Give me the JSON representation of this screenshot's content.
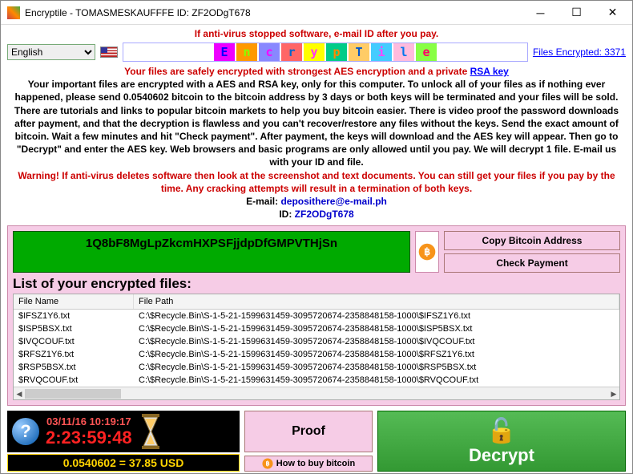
{
  "window": {
    "title": "Encryptile -   TOMASMESKAUFFFE ID: ZF2ODgT678"
  },
  "header": {
    "warning_top": "If anti-virus stopped software, e-mail ID after you pay.",
    "language": "English",
    "banner_letters": [
      "E",
      "n",
      "c",
      "r",
      "y",
      "p",
      "T",
      "i",
      "l",
      "e"
    ],
    "files_encrypted_label": "Files Encrypted: 3371"
  },
  "main_text": {
    "line1_prefix": "Your files are safely encrypted with strongest AES encryption and a private ",
    "rsa_link": "RSA key",
    "body": "Your important files are encrypted with a AES and RSA key, only for this computer. To unlock all of your files as if nothing ever happened, please send 0.0540602 bitcoin to the bitcoin address by 3 days or both keys will be terminated and your files will be sold. There are tutorials and links to popular bitcoin markets to help you buy bitcoin easier. There is video proof the password downloads after payment, and that the decryption is flawless and you can't recover/restore any files without the keys. Send the exact amount of bitcoin. Wait a few minutes and hit \"Check payment\". After payment, the keys will download and the AES key will appear. Then go to \"Decrypt\" and enter the AES key. Web browsers and basic programs are only allowed until you pay. We will decrypt 1 file. E-mail us with your ID and file.",
    "warning2": "Warning! If anti-virus deletes software then look at the screenshot and text documents. You can still get your files if you pay by the time. Any cracking attempts will result in a termination of both keys.",
    "email_label": "E-mail:  ",
    "email": "deposithere@e-mail.ph",
    "id_label": "ID:  ",
    "id": "ZF2ODgT678"
  },
  "bitcoin": {
    "address": "1Q8bF8MgLpZkcmHXPSFjjdpDfGMPVTHjSn",
    "copy_btn": "Copy Bitcoin Address",
    "check_btn": "Check Payment"
  },
  "files": {
    "heading": "List of your encrypted files:",
    "col_name": "File Name",
    "col_path": "File Path",
    "rows": [
      {
        "name": "$IFSZ1Y6.txt",
        "path": "C:\\$Recycle.Bin\\S-1-5-21-1599631459-3095720674-2358848158-1000\\$IFSZ1Y6.txt"
      },
      {
        "name": "$ISP5BSX.txt",
        "path": "C:\\$Recycle.Bin\\S-1-5-21-1599631459-3095720674-2358848158-1000\\$ISP5BSX.txt"
      },
      {
        "name": "$IVQCOUF.txt",
        "path": "C:\\$Recycle.Bin\\S-1-5-21-1599631459-3095720674-2358848158-1000\\$IVQCOUF.txt"
      },
      {
        "name": "$RFSZ1Y6.txt",
        "path": "C:\\$Recycle.Bin\\S-1-5-21-1599631459-3095720674-2358848158-1000\\$RFSZ1Y6.txt"
      },
      {
        "name": "$RSP5BSX.txt",
        "path": "C:\\$Recycle.Bin\\S-1-5-21-1599631459-3095720674-2358848158-1000\\$RSP5BSX.txt"
      },
      {
        "name": "$RVQCOUF.txt",
        "path": "C:\\$Recycle.Bin\\S-1-5-21-1599631459-3095720674-2358848158-1000\\$RVQCOUF.txt"
      }
    ]
  },
  "footer": {
    "date": "03/11/16 10:19:17",
    "countdown": "2:23:59:48",
    "price": "0.0540602 = 37.85 USD",
    "proof_btn": "Proof",
    "howto_btn": "How to buy bitcoin",
    "decrypt_btn": "Decrypt"
  }
}
